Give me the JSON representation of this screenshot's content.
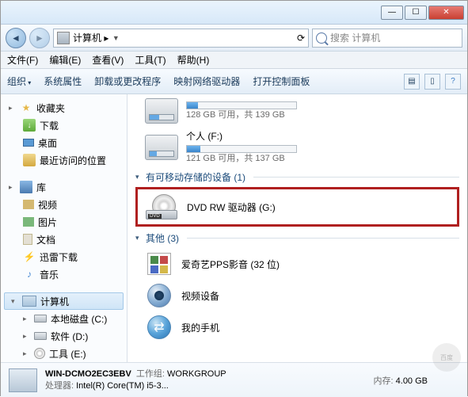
{
  "window": {
    "min": "—",
    "max": "☐",
    "close": "✕"
  },
  "address": {
    "text": "计算机 ▸",
    "refresh": "⟳"
  },
  "search": {
    "placeholder": "搜索 计算机"
  },
  "menu": {
    "file": "文件(F)",
    "edit": "编辑(E)",
    "view": "查看(V)",
    "tools": "工具(T)",
    "help": "帮助(H)"
  },
  "toolbar": {
    "organize": "组织",
    "props": "系统属性",
    "uninstall": "卸载或更改程序",
    "netdrive": "映射网络驱动器",
    "ctrlpanel": "打开控制面板"
  },
  "sidebar": {
    "fav": "收藏夹",
    "fav_items": {
      "dl": "下载",
      "desk": "桌面",
      "recent": "最近访问的位置"
    },
    "lib": "库",
    "lib_items": {
      "vid": "视频",
      "pic": "图片",
      "doc": "文档",
      "thunder": "迅雷下载",
      "music": "音乐"
    },
    "comp": "计算机",
    "comp_items": {
      "c": "本地磁盘 (C:)",
      "soft": "软件 (D:)",
      "tool": "工具 (E:)"
    }
  },
  "content": {
    "drive1": {
      "sub": "128 GB 可用，共 139 GB"
    },
    "drive2": {
      "name": "个人 (F:)",
      "sub": "121 GB 可用，共 137 GB"
    },
    "removable_hdr": "有可移动存储的设备 (1)",
    "dvd": "DVD RW 驱动器 (G:)",
    "other_hdr": "其他 (3)",
    "pps": "爱奇艺PPS影音 (32 位)",
    "cam": "视频设备",
    "phone": "我的手机"
  },
  "details": {
    "name": "WIN-DCMO2EC3EBV",
    "wg_label": "工作组:",
    "wg": "WORKGROUP",
    "cpu_label": "处理器:",
    "cpu": "Intel(R) Core(TM) i5-3...",
    "mem_label": "内存:",
    "mem": "4.00 GB"
  }
}
